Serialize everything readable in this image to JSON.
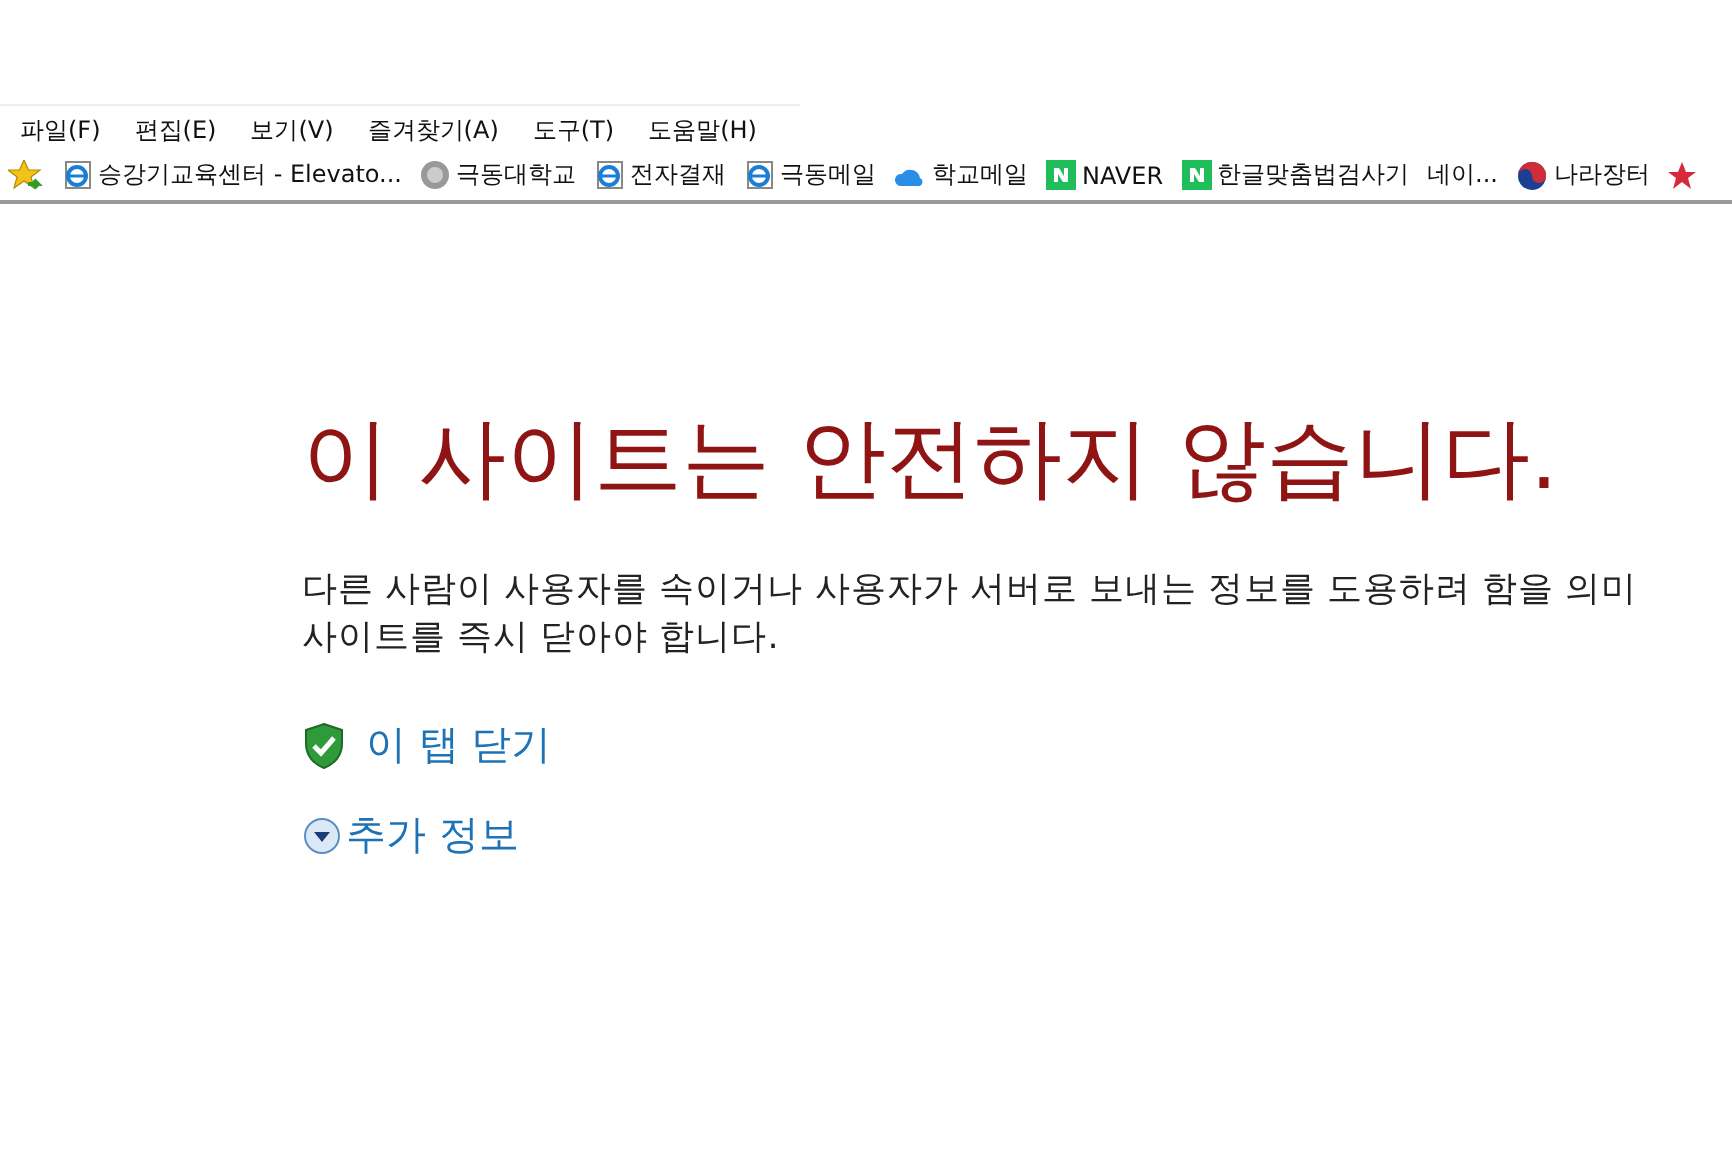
{
  "menu_bar": [
    "파일(F)",
    "편집(E)",
    "보기(V)",
    "즐겨찾기(A)",
    "도구(T)",
    "도움말(H)"
  ],
  "favorites_bar": [
    {
      "kind": "ie",
      "label": "승강기교육센터 - Elevato..."
    },
    {
      "kind": "seal",
      "label": "극동대학교"
    },
    {
      "kind": "ie",
      "label": "전자결재"
    },
    {
      "kind": "ie",
      "label": "극동메일"
    },
    {
      "kind": "cloud",
      "label": "학교메일"
    },
    {
      "kind": "naver",
      "label": "NAVER"
    },
    {
      "kind": "naver",
      "label": "한글맞춤법검사기"
    },
    {
      "kind": "none",
      "label": "네이..."
    },
    {
      "kind": "taegeuk",
      "label": "나라장터"
    },
    {
      "kind": "star"
    }
  ],
  "heading": "이 사이트는 안전하지 않습니다.",
  "message_lines": [
    "다른 사람이 사용자를 속이거나 사용자가 서버로 보내는 정보를 도용하려 함을 의미",
    "사이트를 즉시 닫아야 합니다."
  ],
  "actions": [
    {
      "kind": "shield",
      "label": "이 탭 닫기"
    },
    {
      "kind": "expand",
      "label": "추가 정보"
    }
  ]
}
